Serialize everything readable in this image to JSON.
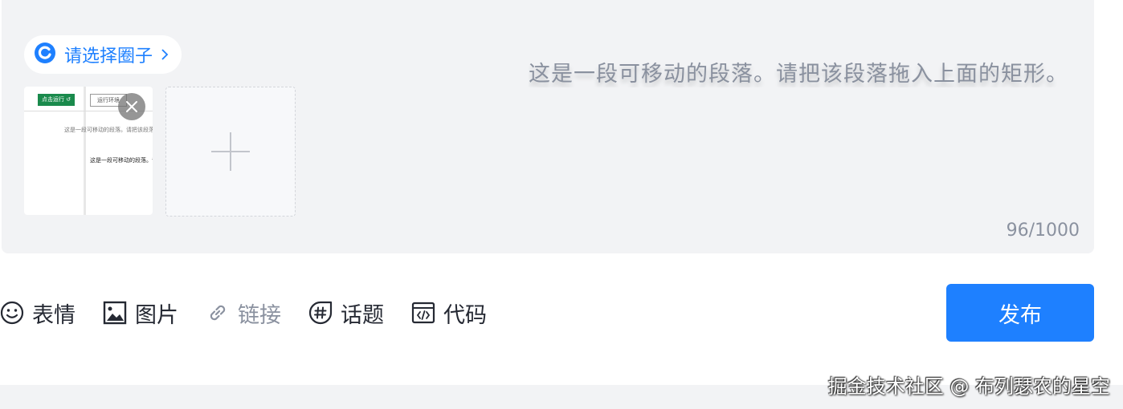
{
  "editor": {
    "circle_selector": {
      "label": "请选择圈子",
      "icon": "circle-logo-icon"
    },
    "draggable_paragraph": "这是一段可移动的段落。请把该段落拖入上面的矩形。",
    "image_thumbnail": {
      "button_green": "点击运行 ↺",
      "button_outline": "运行环境",
      "line1": "这是一段可移动的段落。请把该段落",
      "line2": "这是一段可移动的段落。请"
    },
    "char_count": "96/1000"
  },
  "toolbar": {
    "emoji": "表情",
    "image": "图片",
    "link": "链接",
    "topic": "话题",
    "code": "代码",
    "publish": "发布"
  },
  "watermark": "掘金技术社区 @ 布列瑟农的星空",
  "colors": {
    "accent": "#1e80ff",
    "editor_bg": "#f2f3f5",
    "text": "#252933",
    "muted": "#8a919f"
  }
}
